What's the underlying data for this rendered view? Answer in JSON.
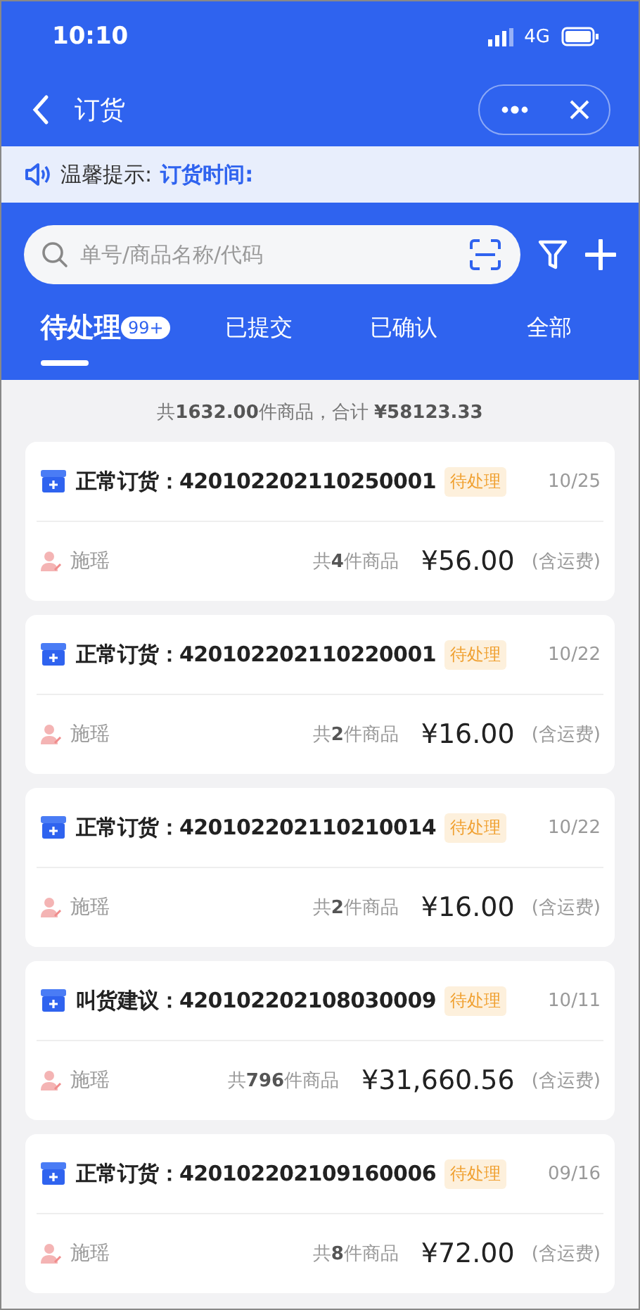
{
  "status_bar": {
    "time": "10:10",
    "network": "4G"
  },
  "nav": {
    "title": "订货"
  },
  "notice": {
    "label": "温馨提示:",
    "text": "订货时间:"
  },
  "search": {
    "placeholder": "单号/商品名称/代码"
  },
  "tabs": [
    {
      "label": "待处理",
      "badge": "99+",
      "selected": true
    },
    {
      "label": "已提交",
      "selected": false
    },
    {
      "label": "已确认",
      "selected": false
    },
    {
      "label": "全部",
      "selected": false
    }
  ],
  "summary": "共**1632.00**件商品，合计 **¥58123.33**",
  "orders": [
    {
      "title": "正常订货：420102202110250001",
      "status": "待处理",
      "date": "10/25",
      "person": "施瑶",
      "count": "共**4**件商品",
      "price": "¥56.00",
      "note": "(含运费)"
    },
    {
      "title": "正常订货：420102202110220001",
      "status": "待处理",
      "date": "10/22",
      "person": "施瑶",
      "count": "共**2**件商品",
      "price": "¥16.00",
      "note": "(含运费)"
    },
    {
      "title": "正常订货：420102202110210014",
      "status": "待处理",
      "date": "10/22",
      "person": "施瑶",
      "count": "共**2**件商品",
      "price": "¥16.00",
      "note": "(含运费)"
    },
    {
      "title": "叫货建议：420102202108030009",
      "status": "待处理",
      "date": "10/11",
      "person": "施瑶",
      "count": "共**796**件商品",
      "price": "¥31,660.56",
      "note": "(含运费)"
    },
    {
      "title": "正常订货：420102202109160006",
      "status": "待处理",
      "date": "09/16",
      "person": "施瑶",
      "count": "共**8**件商品",
      "price": "¥72.00",
      "note": "(含运费)"
    }
  ]
}
